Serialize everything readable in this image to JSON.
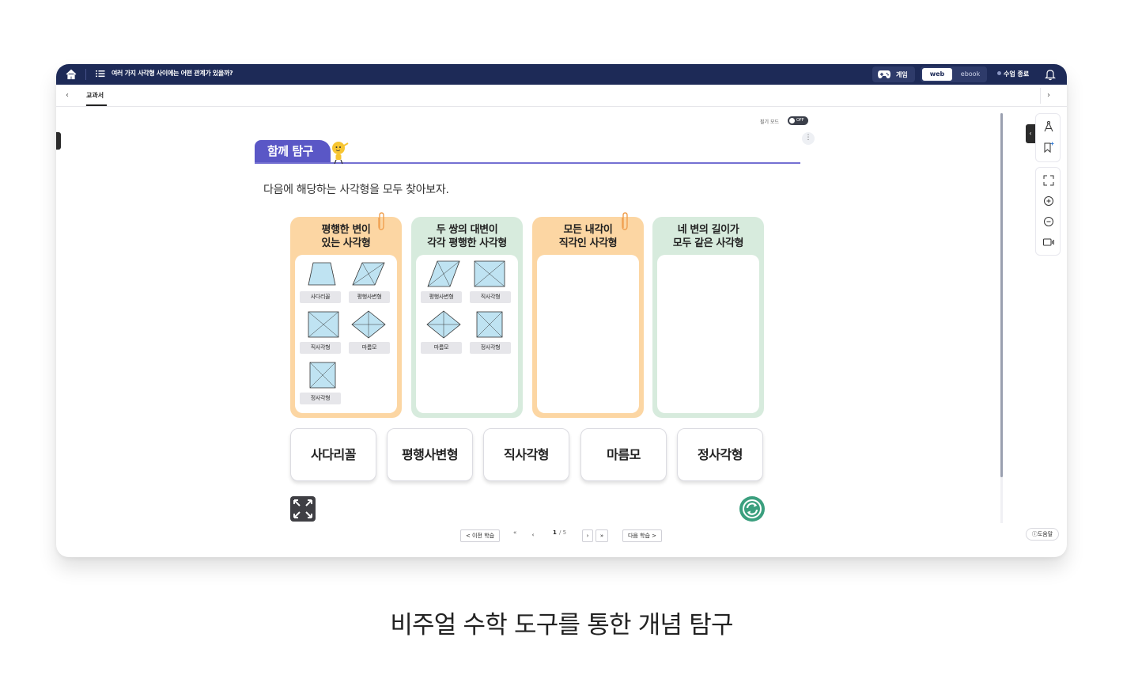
{
  "topbar": {
    "title": "여러 가지 사각형 사이에는 어떤 관계가 있을까?",
    "game_label": "게임",
    "view_web": "web",
    "view_ebook": "ebook",
    "end_class": "수업 종료"
  },
  "tabs": {
    "active": "교과서"
  },
  "pen_mode": {
    "label": "필기 모드",
    "state": "OFF"
  },
  "section": {
    "badge": "함께 탐구",
    "question": "다음에 해당하는 사각형을 모두 찾아보자."
  },
  "categories": [
    {
      "title": "평행한 변이\n있는 사각형",
      "shapes": [
        "사다리꼴",
        "평행사변형",
        "직사각형",
        "마름모",
        "정사각형"
      ]
    },
    {
      "title": "두 쌍의 대변이\n각각 평행한 사각형",
      "shapes": [
        "평행사변형",
        "직사각형",
        "마름모",
        "정사각형"
      ]
    },
    {
      "title": "모든 내각이\n직각인 사각형",
      "shapes": []
    },
    {
      "title": "네 변의 길이가\n모두 같은 사각형",
      "shapes": []
    }
  ],
  "choices": [
    "사다리꼴",
    "평행사변형",
    "직사각형",
    "마름모",
    "정사각형"
  ],
  "pager": {
    "prev_label": "< 이전 학습",
    "current": "1",
    "total": "/ 5",
    "next_label": "다음 학습 >"
  },
  "help_label": "도움말",
  "caption": "비주얼 수학 도구를 통한 개념 탐구",
  "colors": {
    "navy": "#1d2a57",
    "purple": "#5a57c6",
    "orange_card": "#fcd6a3",
    "green_card": "#d7ebdd",
    "reset_green": "#3b9f7e"
  }
}
